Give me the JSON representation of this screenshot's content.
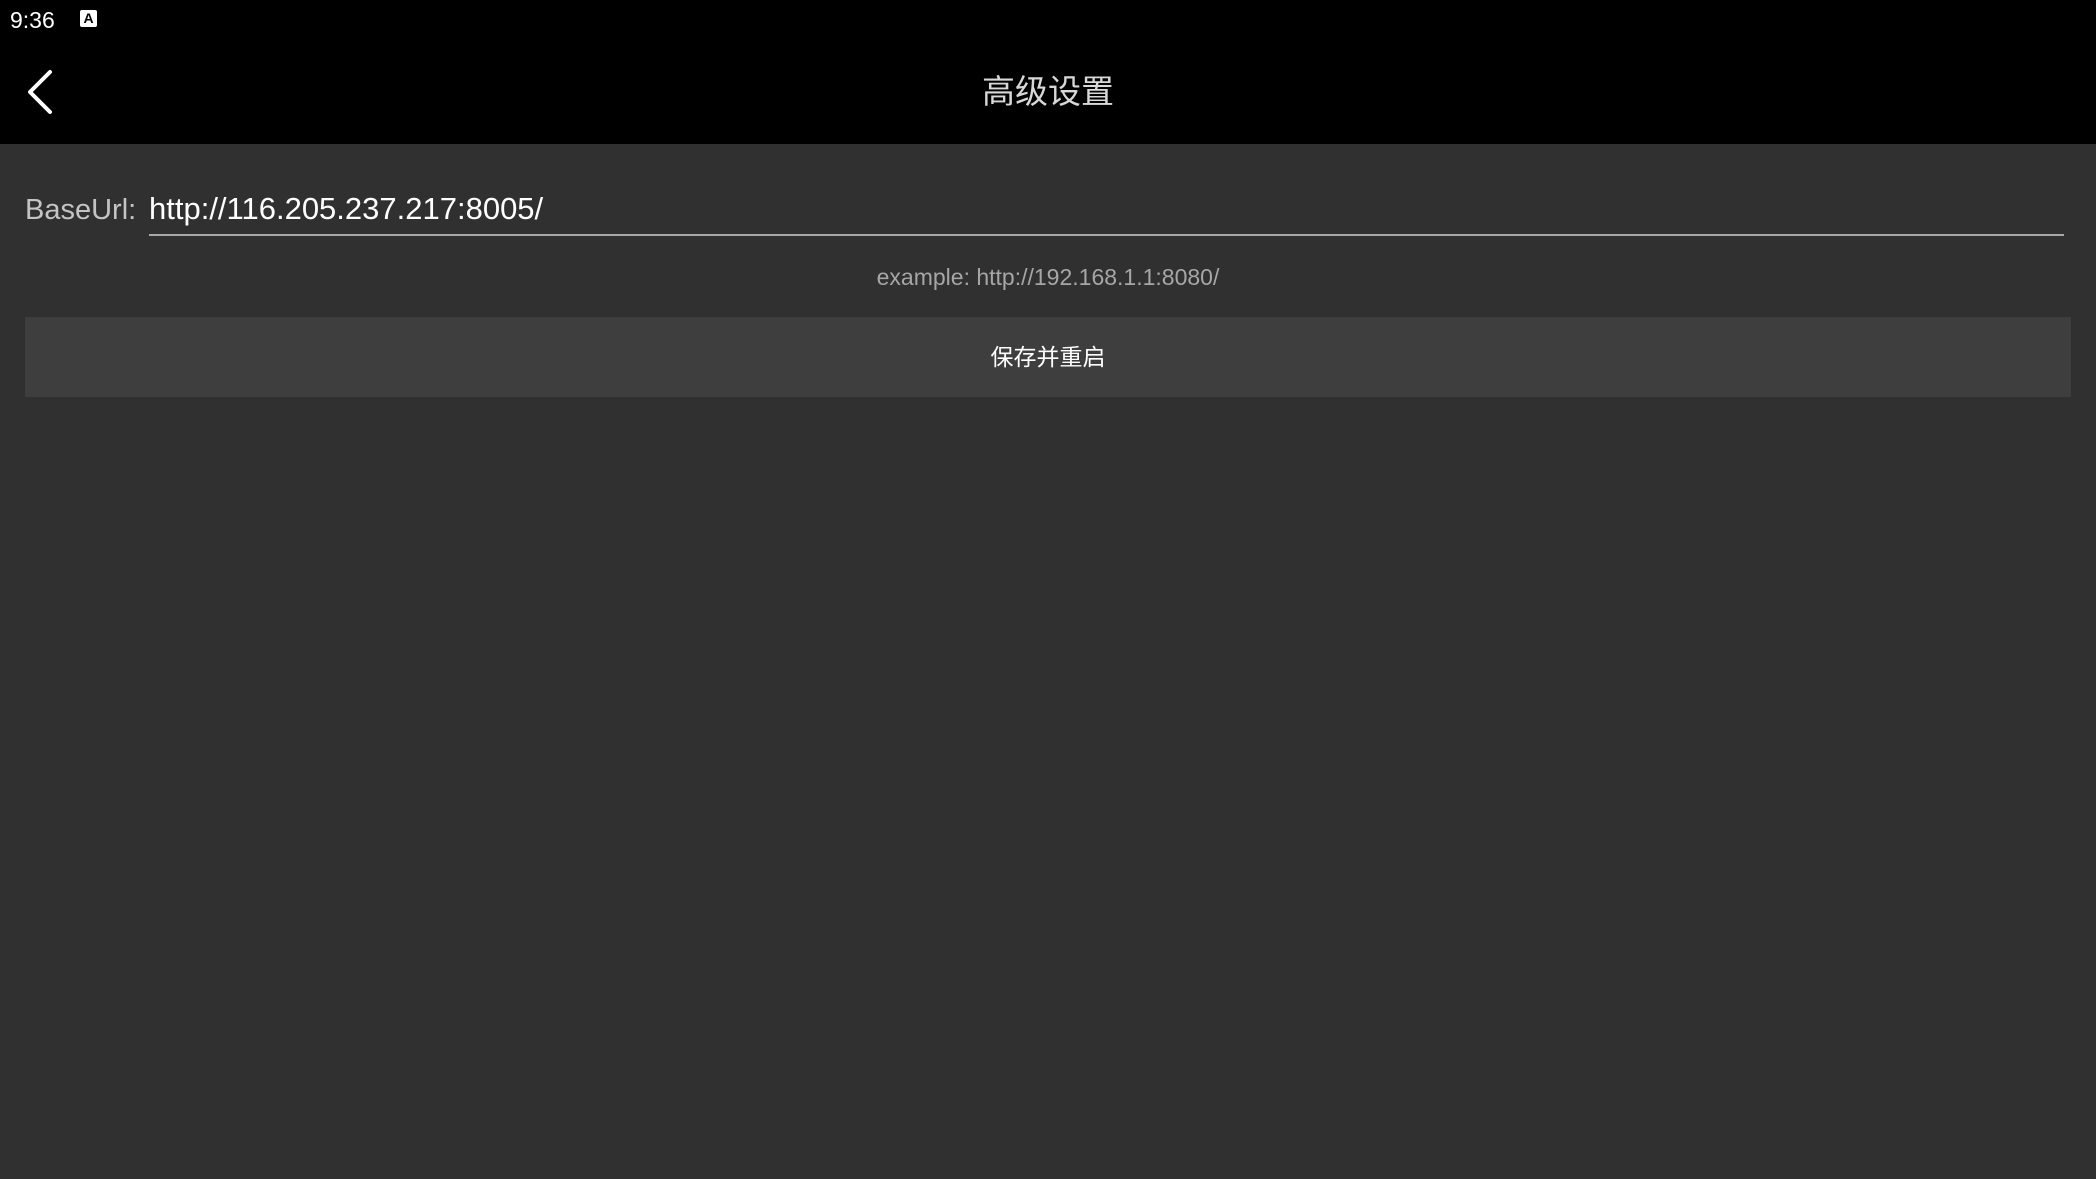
{
  "status_bar": {
    "time": "9:36",
    "notification_icon": "text-input-a-icon",
    "notification_glyph": "A"
  },
  "header": {
    "title": "高级设置",
    "back_icon": "chevron-left-icon"
  },
  "form": {
    "base_url_label": "BaseUrl:",
    "base_url_value": "http://116.205.237.217:8005/",
    "hint": "example: http://192.168.1.1:8080/",
    "save_button_label": "保存并重启"
  },
  "colors": {
    "bar_background": "#000000",
    "page_background": "#303030",
    "button_background": "#3e3e3e"
  }
}
